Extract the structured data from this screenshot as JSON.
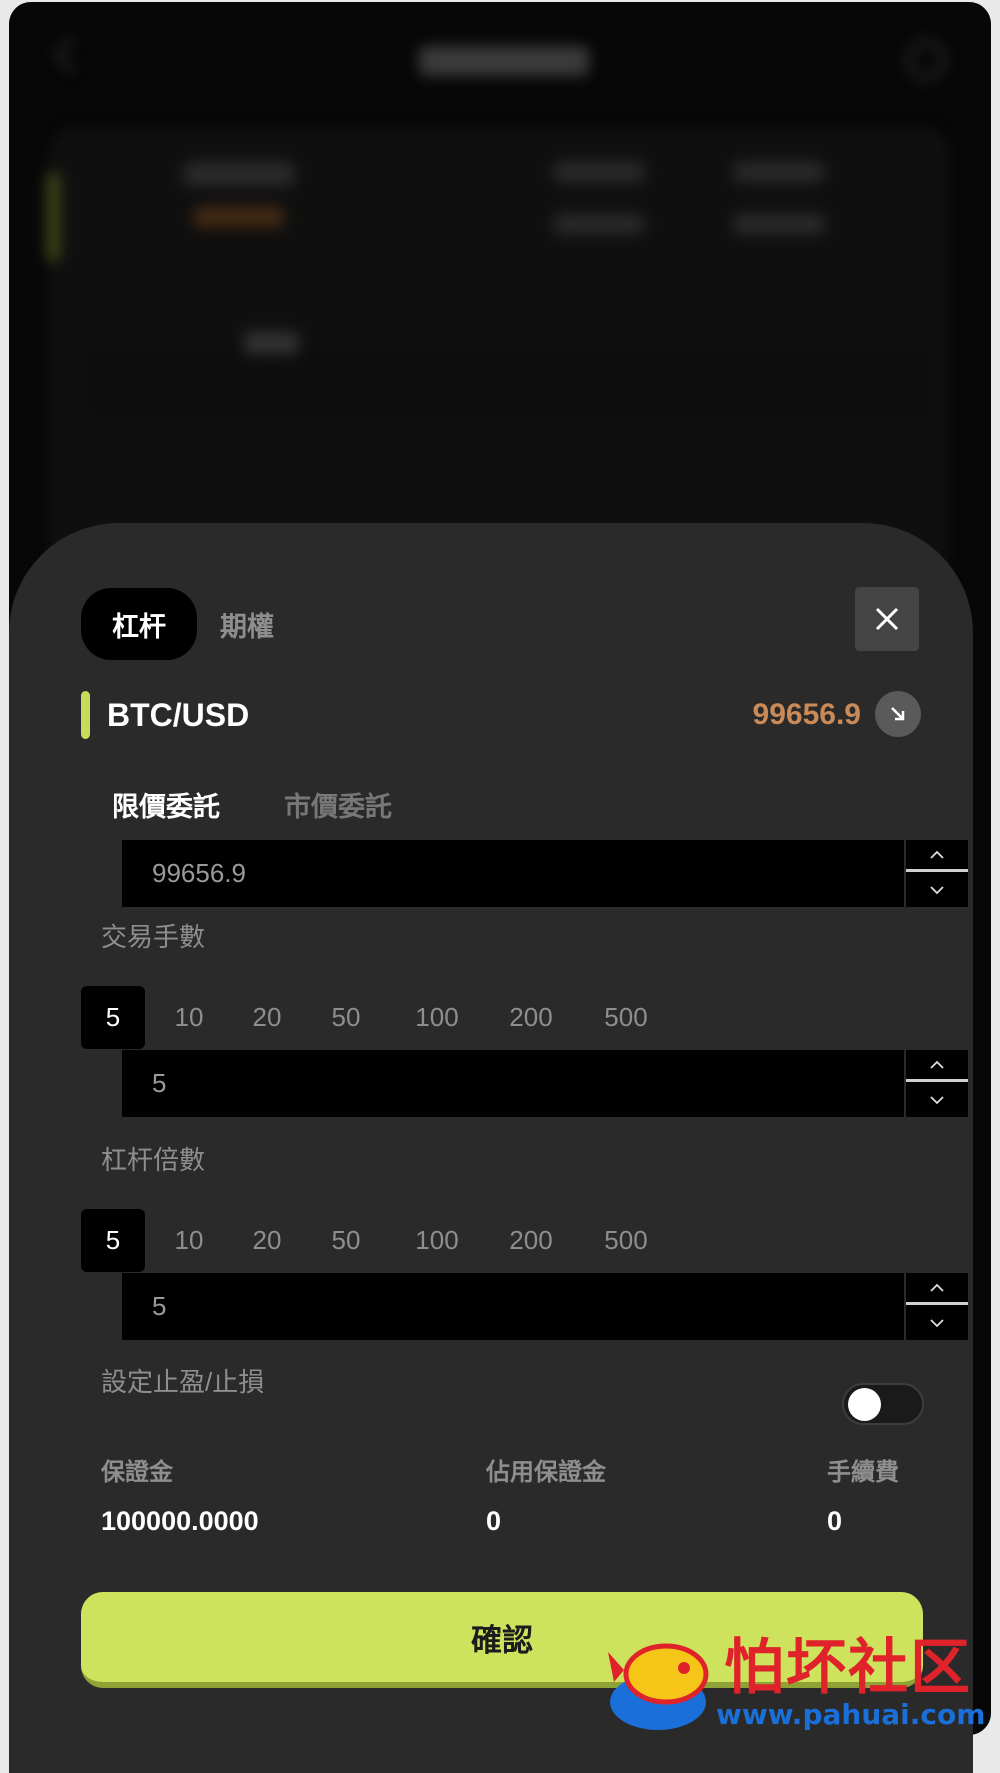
{
  "header": {
    "mode_tabs": [
      "杠杆",
      "期權"
    ],
    "active_mode": "杠杆"
  },
  "pair": {
    "name": "BTC/USD",
    "price": "99656.9",
    "price_color": "#c98a57",
    "accent_color": "#c7dc5a",
    "trend_icon": "arrow-down-right-icon"
  },
  "order_types": [
    "限價委託",
    "市價委託"
  ],
  "price_input": {
    "value": "99656.9"
  },
  "lots": {
    "label": "交易手數",
    "options": [
      "5",
      "10",
      "20",
      "50",
      "100",
      "200",
      "500"
    ],
    "selected": "5",
    "input_value": "5"
  },
  "leverage": {
    "label": "杠杆倍數",
    "options": [
      "5",
      "10",
      "20",
      "50",
      "100",
      "200",
      "500"
    ],
    "selected": "5",
    "input_value": "5"
  },
  "tp_sl": {
    "label": "設定止盈/止損",
    "enabled": false
  },
  "stats": {
    "margin_label": "保證金",
    "margin_value": "100000.0000",
    "used_margin_label": "佔用保證金",
    "used_margin_value": "0",
    "fee_label": "手續費",
    "fee_value": "0"
  },
  "confirm_label": "確認",
  "watermark": {
    "text": "怕坏社区",
    "url": "www.pahuai.com"
  },
  "colors": {
    "confirm": "#cde35d",
    "sheet": "#2a2a2a"
  }
}
